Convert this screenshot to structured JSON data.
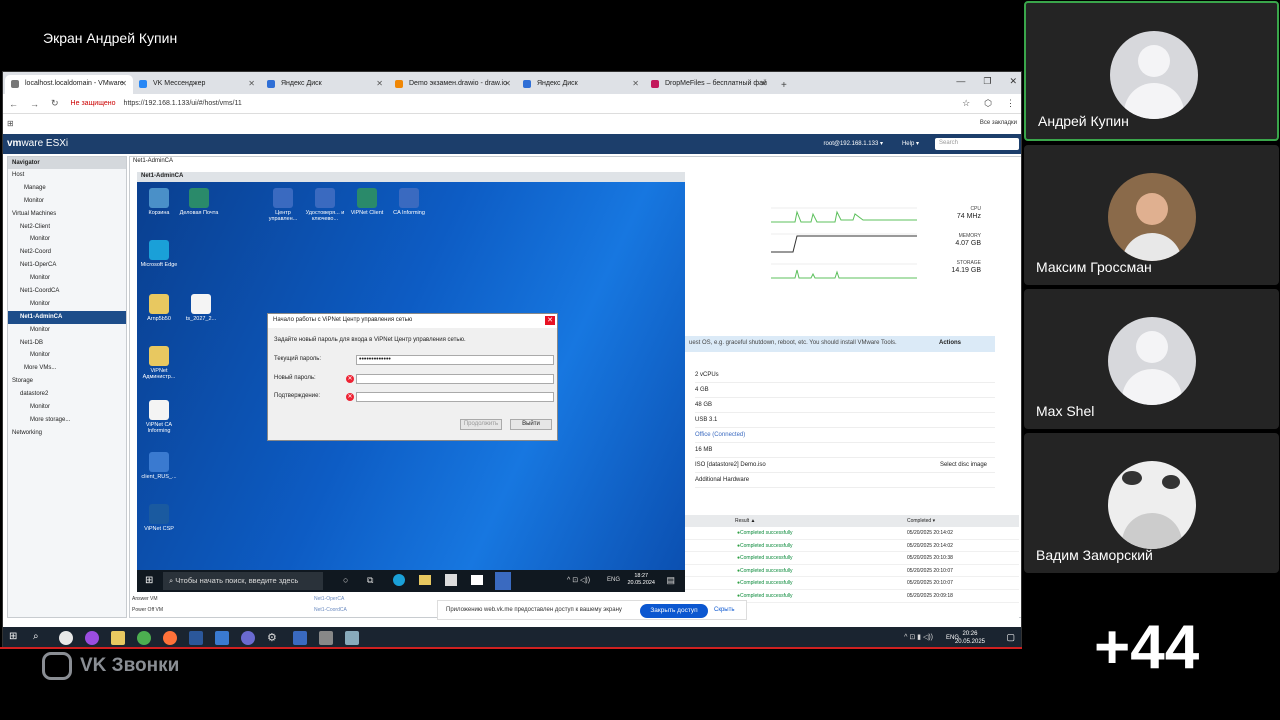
{
  "call": {
    "screen_title": "Экран Андрей Купин",
    "brand": "VK Звонки",
    "more_count": "+44"
  },
  "participants": [
    {
      "name": "Андрей Купин"
    },
    {
      "name": "Максим Гроссман"
    },
    {
      "name": "Max Shel"
    },
    {
      "name": "Вадим Заморский"
    }
  ],
  "browser": {
    "tabs": [
      {
        "label": "localhost.localdomain - VMware",
        "color": "#777777"
      },
      {
        "label": "VK Мессенджер",
        "color": "#2787f5"
      },
      {
        "label": "Яндекс Диск",
        "color": "#2f6fd6"
      },
      {
        "label": "Demo экзамен.drawio - draw.io",
        "color": "#f08705"
      },
      {
        "label": "Яндекс Диск",
        "color": "#2f6fd6"
      },
      {
        "label": "DropMeFiles – бесплатный фай",
        "color": "#c2185b"
      }
    ],
    "security": "Не защищено",
    "url": "https://192.168.1.133/ui/#/host/vms/11",
    "bookmarks_label": "Все закладки"
  },
  "esxi": {
    "logo_vm": "vm",
    "logo_rest": "ware ESXi",
    "user": "root@192.168.1.133 ▾",
    "help": "Help ▾",
    "search_placeholder": "Search",
    "vm_title": "Net1-AdminCA",
    "navigator": {
      "header": "Navigator",
      "items": [
        "Host",
        "Manage",
        "Monitor",
        "Virtual Machines",
        "Net2-Client",
        "Monitor",
        "Net2-Coord",
        "Net1-OperCA",
        "Monitor",
        "Net1-CoordCA",
        "Monitor",
        "Net1-AdminCA",
        "Monitor",
        "Net1-DB",
        "Monitor",
        "More VMs...",
        "Storage",
        "datastore2",
        "Monitor",
        "More storage...",
        "Networking"
      ]
    },
    "stats": {
      "cpu_label": "CPU",
      "cpu": "74 MHz",
      "mem_label": "MEMORY",
      "mem": "4.07 GB",
      "sto_label": "STORAGE",
      "sto": "14.19 GB"
    },
    "banner": "uest OS, e.g. graceful shutdown, reboot, etc. You should install VMware Tools.",
    "banner_actions": "Actions",
    "hardware": [
      {
        "v": "2 vCPUs",
        "r": ""
      },
      {
        "v": "4 GB",
        "r": ""
      },
      {
        "v": "48 GB",
        "r": ""
      },
      {
        "v": "USB 3.1",
        "r": ""
      },
      {
        "v": "Office (Connected)",
        "r": ""
      },
      {
        "v": "16 MB",
        "r": ""
      },
      {
        "v": "ISO [datastore2] Demo.iso",
        "r": "Select disc image"
      },
      {
        "v": "Additional Hardware",
        "r": ""
      }
    ],
    "tasks": {
      "col_result": "Result ▲",
      "col_completed": "Completed ▾",
      "rows": [
        {
          "r": "Completed successfully",
          "d": "05/20/2025 20:14:02"
        },
        {
          "r": "Completed successfully",
          "d": "05/20/2025 20:14:02"
        },
        {
          "r": "Completed successfully",
          "d": "05/20/2025 20:10:38"
        },
        {
          "r": "Completed successfully",
          "d": "05/20/2025 20:10:07"
        },
        {
          "r": "Completed successfully",
          "d": "05/20/2025 20:10:07"
        },
        {
          "r": "Completed successfully",
          "d": "05/20/2025 20:09:18"
        }
      ],
      "left_rows": [
        "Answer VM",
        "Power Off VM"
      ],
      "left_targets": [
        "Net1-OperCA",
        "Net1-CoordCA"
      ]
    }
  },
  "console": {
    "title": "Net1-AdminCA",
    "icons": [
      {
        "label": "Корзина",
        "color": "#4a90c8"
      },
      {
        "label": "Деловая Почта",
        "color": "#2a8a6a"
      },
      {
        "label": "Центр управлен...",
        "color": "#3a6ac0"
      },
      {
        "label": "Удостоверя... и ключево...",
        "color": "#3a6ac0"
      },
      {
        "label": "ViPNet Client",
        "color": "#2a8a6a"
      },
      {
        "label": "CA Informing",
        "color": "#3a6ac0"
      },
      {
        "label": "Microsoft Edge",
        "color": "#1aa0d8"
      },
      {
        "label": "Arnp5b50",
        "color": "#e8c860"
      },
      {
        "label": "ts_2027_2...",
        "color": "#f4f4f4"
      },
      {
        "label": "ViPNet Администр...",
        "color": "#e8c860"
      },
      {
        "label": "ViPNet CA Informing",
        "color": "#f4f4f4"
      },
      {
        "label": "client_RUS_...",
        "color": "#3a7ad0"
      },
      {
        "label": "ViPNet CSP",
        "color": "#1a5aa0"
      }
    ],
    "search": "Чтобы начать поиск, введите здесь",
    "lang": "ENG",
    "time": "18:27",
    "date": "20.05.2024"
  },
  "dialog": {
    "title": "Начало работы с ViPNet Центр управления сетью",
    "subtitle": "Задайте новый пароль для входа в ViPNet Центр управления сетью.",
    "current_label": "Текущий пароль:",
    "current_value": "•••••••••••••",
    "new_label": "Новый пароль:",
    "confirm_label": "Подтверждение:",
    "continue": "Продолжить",
    "exit": "Выйти"
  },
  "notify": {
    "text": "Приложению web.vk.me предоставлен доступ к вашему экрану",
    "allow": "Закрыть доступ",
    "hide": "Скрыть"
  },
  "host": {
    "lang": "ENG",
    "time": "20:26",
    "date": "20.05.2025"
  }
}
